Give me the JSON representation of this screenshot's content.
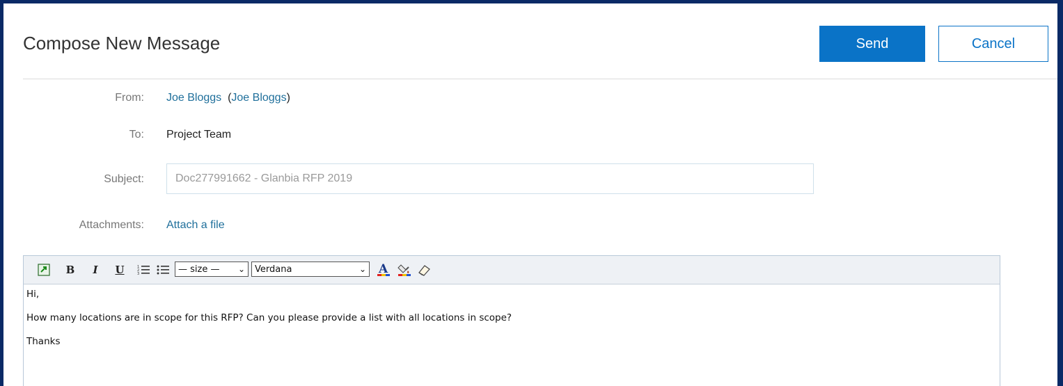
{
  "header": {
    "title": "Compose New Message",
    "send_label": "Send",
    "cancel_label": "Cancel"
  },
  "form": {
    "from_label": "From:",
    "from_name": "Joe Bloggs",
    "from_paren_name": "Joe Bloggs",
    "to_label": "To:",
    "to_value": "Project Team",
    "subject_label": "Subject:",
    "subject_value": "Doc277991662 - Glanbia RFP 2019",
    "attachments_label": "Attachments:",
    "attach_link": "Attach a file"
  },
  "editor": {
    "toolbar": {
      "bold": "B",
      "italic": "I",
      "underline": "U",
      "size_select": "— size —",
      "font_select": "Verdana"
    },
    "body": {
      "line1": "Hi,",
      "line2": "How many locations are in scope for this RFP? Can you please provide a list with all locations in scope?",
      "line3": "Thanks"
    }
  },
  "colors": {
    "accent": "#0a73c7",
    "link": "#1f6f9b",
    "frame_border": "#0a2a66"
  }
}
